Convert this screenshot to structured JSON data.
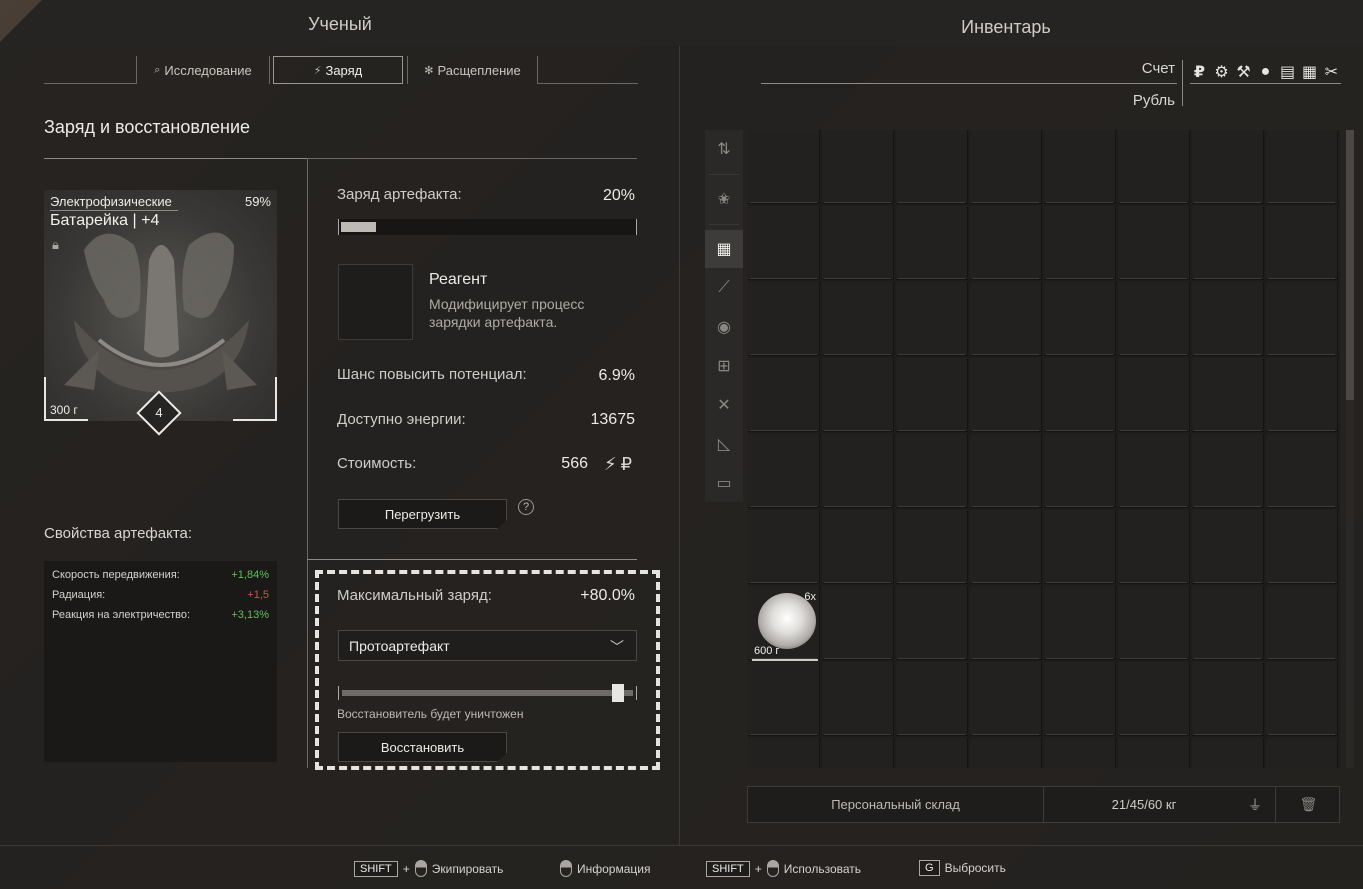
{
  "header": {
    "left_title": "Ученый",
    "right_title": "Инвентарь"
  },
  "tabs": [
    {
      "label": "Исследование",
      "icon": "search-icon",
      "active": false
    },
    {
      "label": "Заряд",
      "icon": "lightning-icon",
      "active": true
    },
    {
      "label": "Расщепление",
      "icon": "split-icon",
      "active": false
    }
  ],
  "section": {
    "title": "Заряд и восстановление"
  },
  "artifact": {
    "category": "Электрофизические",
    "percent": "59%",
    "name": "Батарейка | +4",
    "weight": "300 г",
    "tier": "4"
  },
  "properties": {
    "title": "Свойства артефакта:",
    "rows": [
      {
        "name": "Скорость передвижения:",
        "value": "+1,84%",
        "status": "positive"
      },
      {
        "name": "Радиация:",
        "value": "+1,5",
        "status": "negative"
      },
      {
        "name": "Реакция на электричество:",
        "value": "+3,13%",
        "status": "positive"
      }
    ]
  },
  "charge": {
    "label": "Заряд артефакта:",
    "value": "20%",
    "fill_fraction": 0.12
  },
  "reagent": {
    "title": "Реагент",
    "description": "Модифицирует процесс зарядки артефакта."
  },
  "stats": {
    "chance_label": "Шанс повысить потенциал:",
    "chance_value": "6.9%",
    "energy_label": "Доступно энергии:",
    "energy_value": "13675",
    "cost_label": "Стоимость:",
    "cost_value": "566",
    "cost_icons": [
      "lightning-icon",
      "ruble-icon"
    ]
  },
  "overload_button": "Перегрузить",
  "help_icon": "?",
  "restore": {
    "max_charge_label": "Максимальный заряд:",
    "max_charge_value": "+80.0%",
    "dropdown_value": "Протоартефакт",
    "slider_fraction": 0.95,
    "note": "Восстановитель будет уничтожен",
    "button": "Восстановить"
  },
  "account": {
    "label": "Счет",
    "currency": "Рубль",
    "currency_icons": [
      "ruble-icon",
      "gear-icon",
      "hammer-icon",
      "coin-icon",
      "ticket-icon",
      "card-icon",
      "tools-icon"
    ]
  },
  "filters": [
    {
      "icon": "sort-icon",
      "active": false
    },
    {
      "icon": "star-icon",
      "active": false
    },
    {
      "icon": "grid-icon",
      "active": true
    },
    {
      "icon": "weapon-icon",
      "active": false
    },
    {
      "icon": "artifact-icon",
      "active": false
    },
    {
      "icon": "medkit-icon",
      "active": false
    },
    {
      "icon": "wrench-icon",
      "active": false
    },
    {
      "icon": "ruler-icon",
      "active": false
    },
    {
      "icon": "box-icon",
      "active": false
    }
  ],
  "inventory_item": {
    "count": "6x",
    "weight": "600 г"
  },
  "stash": {
    "name": "Персональный склад",
    "weight": "21/45/60 кг"
  },
  "hints": [
    {
      "key": "SHIFT",
      "plus": "+",
      "label": "Экипировать"
    },
    {
      "label": "Информация"
    },
    {
      "key": "SHIFT",
      "plus": "+",
      "label": "Использовать"
    },
    {
      "key": "G",
      "label": "Выбросить"
    }
  ],
  "colors": {
    "positive": "#5cc15a",
    "negative": "#d9504a",
    "panel": "#242220"
  }
}
